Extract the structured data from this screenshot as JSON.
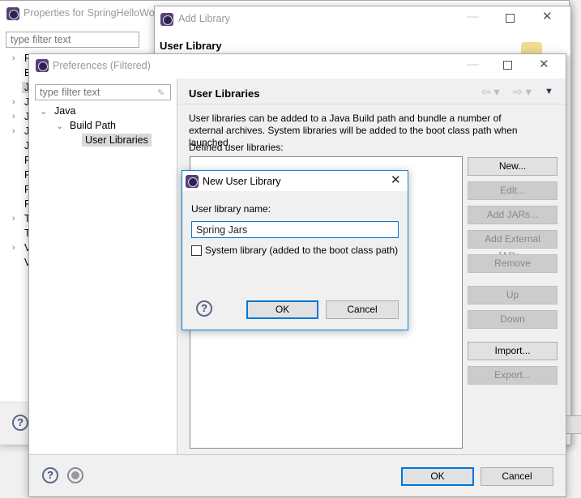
{
  "properties_window": {
    "title": "Properties for SpringHelloWorld",
    "filter_placeholder": "type filter text",
    "tree": [
      {
        "label": "R",
        "chevron": true
      },
      {
        "label": "B",
        "chevron": false
      },
      {
        "label": "J",
        "chevron": false,
        "selected": true
      },
      {
        "label": "J",
        "chevron": true
      },
      {
        "label": "J",
        "chevron": true
      },
      {
        "label": "J",
        "chevron": true
      },
      {
        "label": "J",
        "chevron": false
      },
      {
        "label": "P",
        "chevron": false
      },
      {
        "label": "P",
        "chevron": false
      },
      {
        "label": "R",
        "chevron": false
      },
      {
        "label": "R",
        "chevron": false
      },
      {
        "label": "T",
        "chevron": true
      },
      {
        "label": "T",
        "chevron": false
      },
      {
        "label": "V",
        "chevron": true
      },
      {
        "label": "V",
        "chevron": false
      }
    ]
  },
  "add_library_window": {
    "title": "Add Library",
    "heading": "User Library"
  },
  "preferences_window": {
    "title": "Preferences (Filtered)",
    "filter_placeholder": "type filter text",
    "tree": {
      "java": "Java",
      "build_path": "Build Path",
      "user_libraries": "User Libraries"
    },
    "page_title": "User Libraries",
    "description": "User libraries can be added to a Java Build path and bundle a number of external archives. System libraries will be added to the boot class path when launched.",
    "defined_label": "Defined user libraries:",
    "buttons": {
      "new": "New...",
      "edit": "Edit...",
      "add_jars": "Add JARs...",
      "add_external_jars": "Add External JARs...",
      "remove": "Remove",
      "up": "Up",
      "down": "Down",
      "import": "Import...",
      "export": "Export..."
    },
    "ok": "OK",
    "cancel": "Cancel"
  },
  "new_user_library_dialog": {
    "title": "New User Library",
    "name_label": "User library name:",
    "name_value": "Spring Jars",
    "system_library_label": "System library (added to the boot class path)",
    "system_library_checked": false,
    "ok": "OK",
    "cancel": "Cancel"
  },
  "colors": {
    "accent": "#0078d7",
    "icon": "#5a3d7a"
  }
}
